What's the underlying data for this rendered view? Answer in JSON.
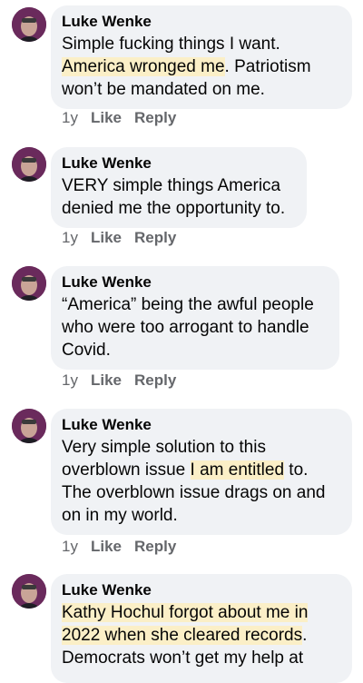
{
  "colors": {
    "bubble_bg": "#f0f2f5",
    "highlight": "#fbefc7",
    "meta_text": "#65676b",
    "avatar_bg": "#6a2a5c"
  },
  "comments": [
    {
      "author": "Luke Wenke",
      "segments": [
        {
          "text": "Simple fucking things I want. ",
          "highlight": false
        },
        {
          "text": "America wronged me",
          "highlight": true
        },
        {
          "text": ".  Patriotism won’t be mandated on me.",
          "highlight": false
        }
      ],
      "time": "1y",
      "like": "Like",
      "reply": "Reply"
    },
    {
      "author": "Luke Wenke",
      "segments": [
        {
          "text": "VERY simple things America denied me the opportunity to.",
          "highlight": false
        }
      ],
      "time": "1y",
      "like": "Like",
      "reply": "Reply"
    },
    {
      "author": "Luke Wenke",
      "segments": [
        {
          "text": "“America” being the awful people who were too arrogant to handle Covid.",
          "highlight": false
        }
      ],
      "time": "1y",
      "like": "Like",
      "reply": "Reply"
    },
    {
      "author": "Luke Wenke",
      "segments": [
        {
          "text": "Very simple solution to this overblown issue ",
          "highlight": false
        },
        {
          "text": "I am entitled",
          "highlight": true
        },
        {
          "text": " to. The overblown issue drags on and on in my world.",
          "highlight": false
        }
      ],
      "time": "1y",
      "like": "Like",
      "reply": "Reply"
    },
    {
      "author": "Luke Wenke",
      "segments": [
        {
          "text": "Kathy Hochul forgot about me in 2022 when she cleared records",
          "highlight": true
        },
        {
          "text": ". Democrats won’t get my help at",
          "highlight": false
        }
      ]
    }
  ]
}
